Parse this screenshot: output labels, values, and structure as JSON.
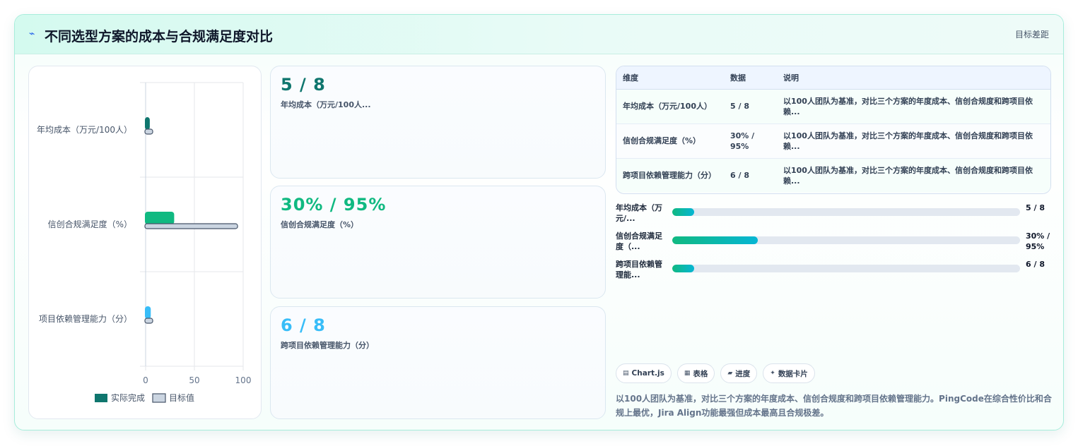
{
  "header": {
    "title": "不同选型方案的成本与合规满足度对比",
    "title_icon": "lightning-icon",
    "right_link": "目标差距"
  },
  "chart_data": {
    "type": "bar",
    "orientation": "horizontal",
    "categories": [
      "年均成本（万元/100人）",
      "信创合规满足度（%）",
      "项目依赖管理能力（分）"
    ],
    "series": [
      {
        "name": "实际完成",
        "values": [
          5,
          30,
          6
        ],
        "colors": [
          "#0f766e",
          "#10b981",
          "#38bdf8"
        ]
      },
      {
        "name": "目标值",
        "values": [
          8,
          95,
          8
        ],
        "color": "#cbd5e1"
      }
    ],
    "xlim": [
      0,
      100
    ],
    "xticks": [
      "0",
      "50",
      "100"
    ],
    "legend_position": "bottom",
    "grid": true
  },
  "stats": [
    {
      "value": "5 / 8",
      "label": "年均成本（万元/100人...",
      "color": "#0f766e"
    },
    {
      "value": "30% / 95%",
      "label": "信创合规满足度（%）",
      "color": "#10b981"
    },
    {
      "value": "6 / 8",
      "label": "跨项目依赖管理能力（分）",
      "color": "#38bdf8"
    }
  ],
  "table": {
    "headers": [
      "维度",
      "数据",
      "说明"
    ],
    "rows": [
      [
        "年均成本（万元/100人）",
        "5 / 8",
        "以100人团队为基准，对比三个方案的年度成本、信创合规度和跨项目依赖..."
      ],
      [
        "信创合规满足度（%）",
        "30% / 95%",
        "以100人团队为基准，对比三个方案的年度成本、信创合规度和跨项目依赖..."
      ],
      [
        "跨项目依赖管理能力（分）",
        "6 / 8",
        "以100人团队为基准，对比三个方案的年度成本、信创合规度和跨项目依赖..."
      ]
    ]
  },
  "progress": [
    {
      "label": "年均成本（万元/...",
      "value_text": "5 / 8",
      "fraction": 0.0625
    },
    {
      "label": "信创合规满足度（...",
      "value_text": "30% / 95%",
      "fraction": 0.245
    },
    {
      "label": "跨项目依赖管理能...",
      "value_text": "6 / 8",
      "fraction": 0.0625
    }
  ],
  "chips": [
    {
      "icon": "▤",
      "label": "Chart.js"
    },
    {
      "icon": "▦",
      "label": "表格"
    },
    {
      "icon": "▰",
      "label": "进度"
    },
    {
      "icon": "✦",
      "label": "数据卡片"
    }
  ],
  "description": "以100人团队为基准，对比三个方案的年度成本、信创合规度和跨项目依赖管理能力。PingCode在综合性价比和合规上最优，Jira Align功能最强但成本最高且合规极差。"
}
